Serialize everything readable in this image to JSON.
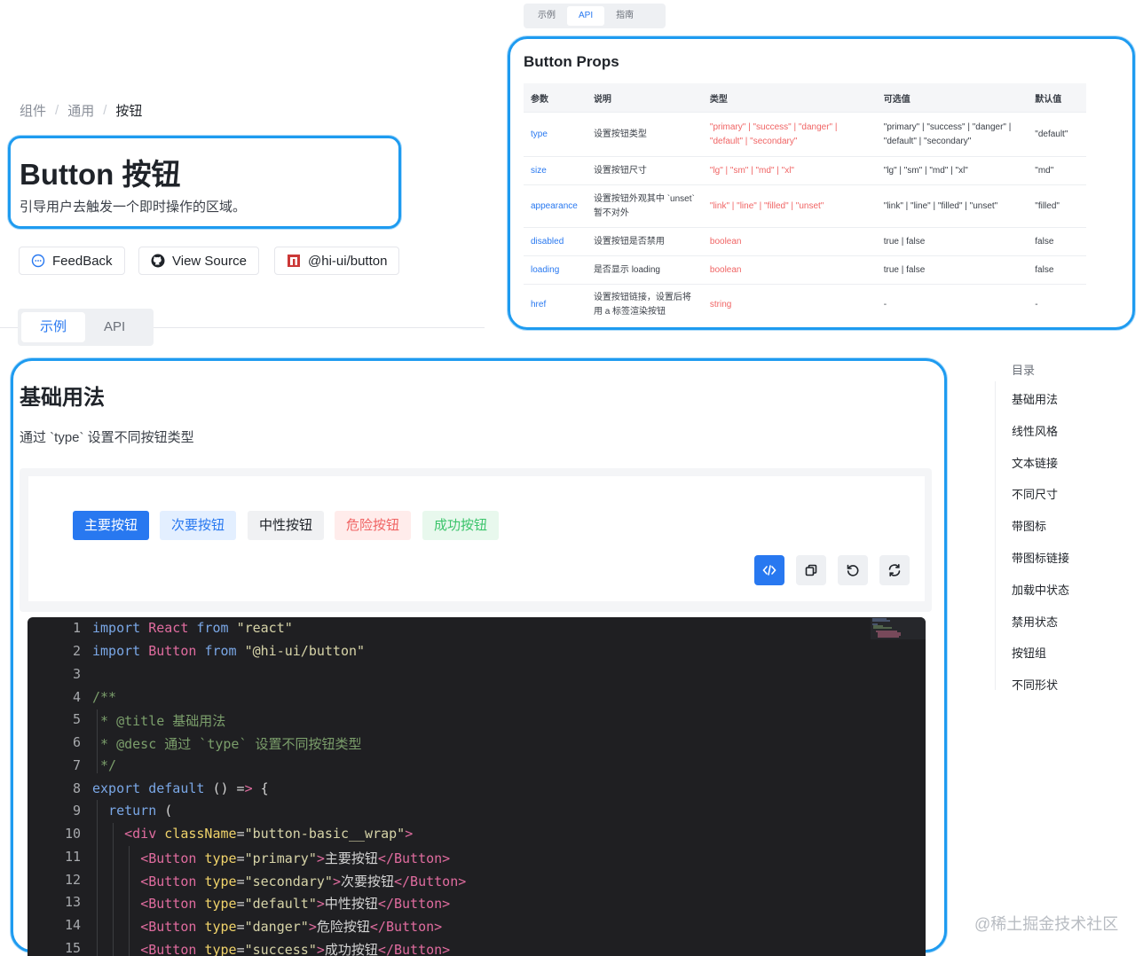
{
  "breadcrumb": [
    "组件",
    "通用",
    "按钮"
  ],
  "header": {
    "title": "Button 按钮",
    "description": "引导用户去触发一个即时操作的区域。"
  },
  "actions": {
    "feedback": "FeedBack",
    "view_source": "View Source",
    "package": "@hi-ui/button"
  },
  "tabs": [
    "示例",
    "API"
  ],
  "api_panel": {
    "tabs": [
      "示例",
      "API",
      "指南"
    ],
    "props_title": "Button Props",
    "columns": [
      "参数",
      "说明",
      "类型",
      "可选值",
      "默认值"
    ],
    "rows": [
      [
        "type",
        "设置按钮类型",
        "\"primary\" | \"success\" | \"danger\" | \"default\" | \"secondary\"",
        "\"primary\" | \"success\" | \"danger\" | \"default\" | \"secondary\"",
        "\"default\""
      ],
      [
        "size",
        "设置按钮尺寸",
        "\"lg\" | \"sm\" | \"md\" | \"xl\"",
        "\"lg\" | \"sm\" | \"md\" | \"xl\"",
        "\"md\""
      ],
      [
        "appearance",
        "设置按钮外观其中 `unset` 暂不对外",
        "\"link\" | \"line\" | \"filled\" | \"unset\"",
        "\"link\" | \"line\" | \"filled\" | \"unset\"",
        "\"filled\""
      ],
      [
        "disabled",
        "设置按钮是否禁用",
        "boolean",
        "true | false",
        "false"
      ],
      [
        "loading",
        "是否显示 loading",
        "boolean",
        "true | false",
        "false"
      ],
      [
        "href",
        "设置按钮链接，设置后将用 a 标签渲染按钮",
        "string",
        "-",
        "-"
      ]
    ]
  },
  "section": {
    "title": "基础用法",
    "description": "通过 `type` 设置不同按钮类型"
  },
  "demo_buttons": [
    "主要按钮",
    "次要按钮",
    "中性按钮",
    "危险按钮",
    "成功按钮"
  ],
  "code_lines": [
    "import React from \"react\"",
    "import Button from \"@hi-ui/button\"",
    "",
    "/**",
    " * @title 基础用法",
    " * @desc 通过 `type` 设置不同按钮类型",
    " */",
    "export default () => {",
    "  return (",
    "    <div className=\"button-basic__wrap\">",
    "      <Button type=\"primary\">主要按钮</Button>",
    "      <Button type=\"secondary\">次要按钮</Button>",
    "      <Button type=\"default\">中性按钮</Button>",
    "      <Button type=\"danger\">危险按钮</Button>",
    "      <Button type=\"success\">成功按钮</Button>"
  ],
  "line_numbers": [
    "1",
    "2",
    "3",
    "4",
    "5",
    "6",
    "7",
    "8",
    "9",
    "10",
    "11",
    "12",
    "13",
    "14",
    "15"
  ],
  "toc": {
    "title": "目录",
    "items": [
      "基础用法",
      "线性风格",
      "文本链接",
      "不同尺寸",
      "带图标",
      "带图标链接",
      "加载中状态",
      "禁用状态",
      "按钮组",
      "不同形状"
    ]
  },
  "watermark": "@稀土掘金技术社区",
  "colors": {
    "primary": "#2878f0",
    "annotation": "#1e9bf0",
    "danger": "#f06464",
    "success": "#3cc46b"
  }
}
